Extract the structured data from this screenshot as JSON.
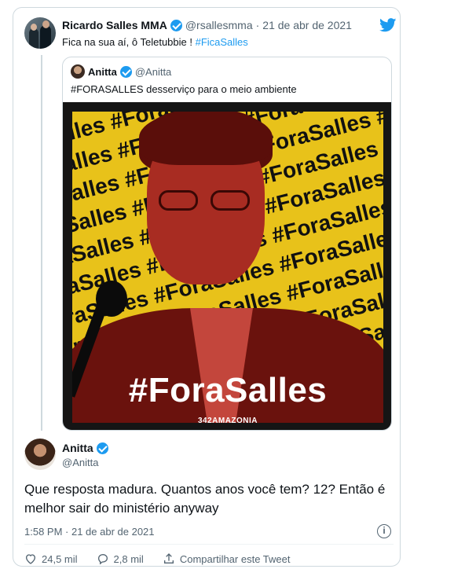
{
  "tweet": {
    "author_name": "Ricardo Salles MMA",
    "author_handle": "@rsallesmma",
    "date_sep": "·",
    "date": "21 de abr de 2021",
    "text_prefix": "Fica na sua aí, ô Teletubbie ! ",
    "hashtag": "#FicaSalles"
  },
  "quoted": {
    "author_name": "Anitta",
    "author_handle": "@Anitta",
    "text": "#FORASALLES desserviço para o meio ambiente",
    "image": {
      "big_hashtag": "#ForaSalles",
      "brand": "342AMAZONIA",
      "background_pattern_text": "#ForaSalles"
    }
  },
  "reply": {
    "author_name": "Anitta",
    "author_handle": "@Anitta",
    "text": "Que resposta madura. Quantos anos você tem? 12? Então é melhor sair do ministério anyway",
    "timestamp": "1:58 PM · 21 de abr de 2021",
    "likes": "24,5 mil",
    "replies": "2,8 mil",
    "share_label": "Compartilhar este Tweet"
  },
  "colors": {
    "accent": "#1d9bf0",
    "muted": "#536471",
    "poster_yellow": "#e8c21a",
    "poster_red": "#a82c22"
  },
  "icons": [
    "twitter-bird-icon",
    "verified-badge-icon",
    "info-icon",
    "heart-icon",
    "reply-icon",
    "share-icon"
  ]
}
